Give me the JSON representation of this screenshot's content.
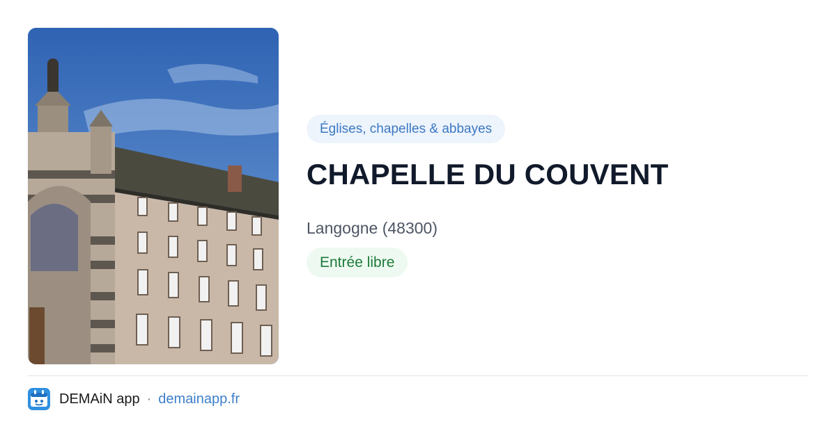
{
  "card": {
    "category": "Églises, chapelles & abbayes",
    "title": "CHAPELLE DU COUVENT",
    "location": "Langogne (48300)",
    "access": "Entrée libre"
  },
  "footer": {
    "app_name": "DEMAiN app",
    "separator": "·",
    "site": "demainapp.fr"
  },
  "colors": {
    "category_text": "#3b78c4",
    "category_bg": "#eef4fc",
    "access_text": "#1c7a3a",
    "access_bg": "#eefaf1",
    "link": "#3d7fc9",
    "app_icon_bg": "#2f8fe0"
  },
  "icons": {
    "app": "demain-app-icon"
  }
}
